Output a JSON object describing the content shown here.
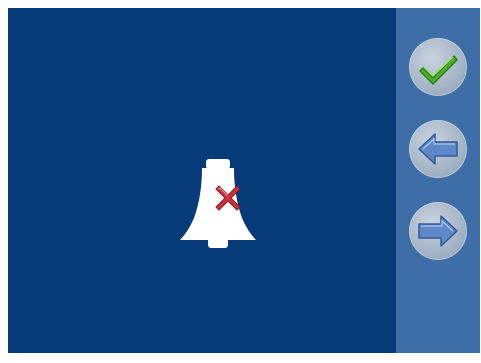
{
  "screen": {
    "main_icon": "bell-muted-icon",
    "colors": {
      "main_background": "#063a78",
      "side_background": "#3d6ea8"
    }
  },
  "sidebar": {
    "buttons": [
      {
        "name": "confirm",
        "icon": "checkmark-icon"
      },
      {
        "name": "back",
        "icon": "arrow-left-icon"
      },
      {
        "name": "forward",
        "icon": "arrow-right-icon"
      }
    ]
  }
}
